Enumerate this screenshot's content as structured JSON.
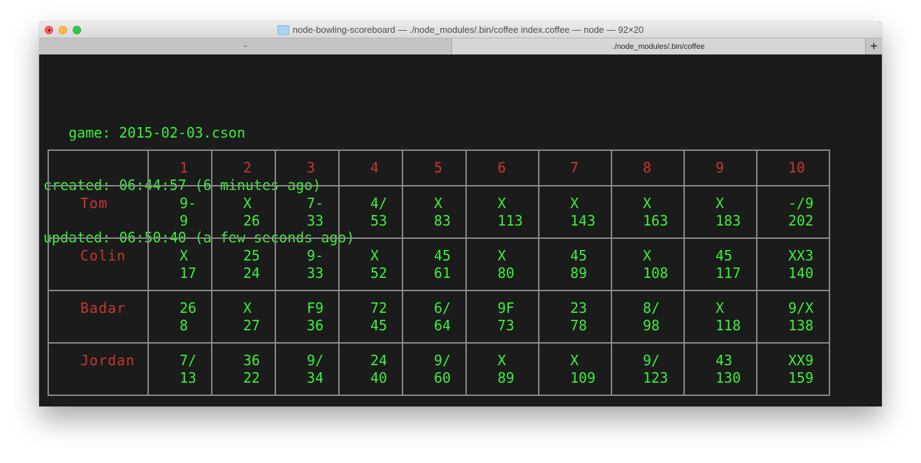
{
  "window": {
    "title": "node-bowling-scoreboard — ./node_modules/.bin/coffee index.coffee — node — 92×20",
    "title_icon": "folder-icon",
    "tabs": [
      {
        "label": "~",
        "active": false
      },
      {
        "label": "./node_modules/.bin/coffee",
        "active": true
      }
    ],
    "new_tab_label": "+"
  },
  "terminal": {
    "lines": [
      "   game: 2015-02-03.cson",
      "created: 06:44:57 (6 minutes ago)",
      "updated: 06:50:40 (a few seconds ago)"
    ]
  },
  "scoreboard": {
    "frame_headers": [
      "1",
      "2",
      "3",
      "4",
      "5",
      "6",
      "7",
      "8",
      "9",
      "10"
    ],
    "players": [
      {
        "name": "Tom",
        "frames": [
          {
            "marks": "9-",
            "total": "9"
          },
          {
            "marks": "X",
            "total": "26"
          },
          {
            "marks": "7-",
            "total": "33"
          },
          {
            "marks": "4/",
            "total": "53"
          },
          {
            "marks": "X",
            "total": "83"
          },
          {
            "marks": "X",
            "total": "113"
          },
          {
            "marks": "X",
            "total": "143"
          },
          {
            "marks": "X",
            "total": "163"
          },
          {
            "marks": "X",
            "total": "183"
          },
          {
            "marks": "-/9",
            "total": "202"
          }
        ]
      },
      {
        "name": "Colin",
        "frames": [
          {
            "marks": "X",
            "total": "17"
          },
          {
            "marks": "25",
            "total": "24"
          },
          {
            "marks": "9-",
            "total": "33"
          },
          {
            "marks": "X",
            "total": "52"
          },
          {
            "marks": "45",
            "total": "61"
          },
          {
            "marks": "X",
            "total": "80"
          },
          {
            "marks": "45",
            "total": "89"
          },
          {
            "marks": "X",
            "total": "108"
          },
          {
            "marks": "45",
            "total": "117"
          },
          {
            "marks": "XX3",
            "total": "140"
          }
        ]
      },
      {
        "name": "Badar",
        "frames": [
          {
            "marks": "26",
            "total": "8"
          },
          {
            "marks": "X",
            "total": "27"
          },
          {
            "marks": "F9",
            "total": "36"
          },
          {
            "marks": "72",
            "total": "45"
          },
          {
            "marks": "6/",
            "total": "64"
          },
          {
            "marks": "9F",
            "total": "73"
          },
          {
            "marks": "23",
            "total": "78"
          },
          {
            "marks": "8/",
            "total": "98"
          },
          {
            "marks": "X",
            "total": "118"
          },
          {
            "marks": "9/X",
            "total": "138"
          }
        ]
      },
      {
        "name": "Jordan",
        "frames": [
          {
            "marks": "7/",
            "total": "13"
          },
          {
            "marks": "36",
            "total": "22"
          },
          {
            "marks": "9/",
            "total": "34"
          },
          {
            "marks": "24",
            "total": "40"
          },
          {
            "marks": "9/",
            "total": "60"
          },
          {
            "marks": "X",
            "total": "89"
          },
          {
            "marks": "X",
            "total": "109"
          },
          {
            "marks": "9/",
            "total": "123"
          },
          {
            "marks": "43",
            "total": "130"
          },
          {
            "marks": "XX9",
            "total": "159"
          }
        ]
      }
    ]
  },
  "colors": {
    "terminal_bg": "#1b1b1b",
    "text_green": "#3cf03c",
    "text_red": "#c8372c",
    "grid": "#8a8a8a"
  }
}
